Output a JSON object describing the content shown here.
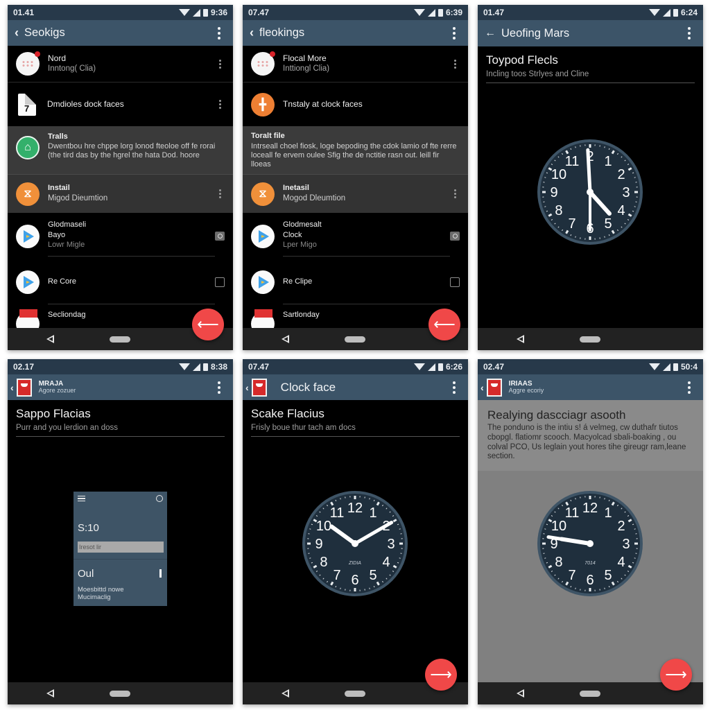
{
  "colors": {
    "status_bar": "#27394a",
    "app_bar": "#3c5468",
    "fab": "#f04848",
    "clock_face": "#1f2f3d",
    "clock_ring": "#3e5466",
    "screen_bg": "#000000",
    "highlight_row": "#3b3b3b",
    "gray_panel": "#808080"
  },
  "screens": [
    {
      "status": {
        "left_time": "01.41",
        "right_time": "9:36"
      },
      "appbar": {
        "back_icon": "chevron-left",
        "title": "Seokigs",
        "menu_icon": "more-vertical"
      },
      "list": [
        {
          "icon": "notification-dots-icon",
          "title": "Nord",
          "subtitle": "Inntong( Clia)",
          "action": "more-vertical"
        },
        {
          "icon": "calendar-document-icon",
          "icon_text": "7",
          "title": "Dmdioles dock faces",
          "action": "more-vertical"
        },
        {
          "icon": "clock-grid-icon",
          "title": "Tralls",
          "body": "Dwentbou hre chppe lorg lonod fteoloe off fe rorai (the tird das by the hgrel the hata Dod. hoore",
          "highlight": true
        },
        {
          "icon": "hourglass-icon",
          "title": "Instail",
          "subtitle": "Migod Dieumtion",
          "action": "more-vertical",
          "highlight": true
        },
        {
          "icon": "play-store-icon",
          "title": "Glodmaseli",
          "subtitle": "Bayo",
          "subtitle2": "Lowr Migle",
          "action": "camera"
        },
        {
          "icon": "play-store-icon",
          "title": "Re Core",
          "action": "checkbox"
        },
        {
          "icon": "calendar-icon",
          "title": "Secliondag"
        }
      ],
      "fab": {
        "icon": "arrow-left"
      }
    },
    {
      "status": {
        "left_time": "07.47",
        "right_time": "6:39"
      },
      "appbar": {
        "back_icon": "chevron-left",
        "title": "fleokings",
        "menu_icon": "more-vertical"
      },
      "list": [
        {
          "icon": "notification-dots-icon",
          "title": "Flocal More",
          "subtitle": "Inttiongl Clia)",
          "action": "more-vertical"
        },
        {
          "icon": "clock-grid-icon",
          "title": "Tnstaly at clock faces"
        },
        {
          "title": "Toralt file",
          "body": "Intrseall choel fiosk, loge bepoding the cdok lamio of fte rerre loceall fe ervem oulee Sfig the de nctitie rasn out. leill fir lloeas",
          "highlight": true
        },
        {
          "icon": "hourglass-icon",
          "title": "Inetasil",
          "subtitle": "Mogod Dleumtion",
          "action": "more-vertical",
          "highlight": true
        },
        {
          "icon": "play-store-icon",
          "title": "Glodmesalt",
          "subtitle": "Clock",
          "subtitle2": "Lper Migo",
          "action": "camera"
        },
        {
          "icon": "play-store-icon",
          "title": "Re Clipe",
          "action": "checkbox"
        },
        {
          "icon": "calendar-icon",
          "title": "Sartlonday"
        }
      ],
      "fab": {
        "icon": "arrow-left"
      }
    },
    {
      "status": {
        "left_time": "01.47",
        "right_time": "6:24"
      },
      "appbar": {
        "back_icon": "arrow-left",
        "title": "Ueofing Mars",
        "menu_icon": "more-vertical"
      },
      "heading": "Toypod Flecls",
      "subheading": "Incling toos Strlyes and Cline",
      "clock": {
        "hour_hand_hour": 4.6,
        "minute_hand_minute": 59.5,
        "second_hand_second": 30,
        "numerals": [
          "2",
          "1",
          "2",
          "3",
          "4",
          "5",
          "6",
          "7",
          "8",
          "9",
          "10",
          "11"
        ]
      }
    },
    {
      "status": {
        "left_time": "02.17",
        "right_time": "8:38"
      },
      "appbar": {
        "back_icon": "chevron-left",
        "title": "MRAJA",
        "subtitle": "Agore zozuer",
        "menu_icon": "more-vertical"
      },
      "heading": "Sappo Flacias",
      "subheading": "Purr and you lerdion an doss",
      "widget": {
        "menu_icon": "hamburger-menu",
        "power_icon": "power",
        "time": "S:10",
        "input_text": "Iresot lir",
        "label": "Oul",
        "description_line1": "Moesbittd nowe",
        "description_line2": "Mucimaclig"
      }
    },
    {
      "status": {
        "left_time": "07.47",
        "right_time": "6:26"
      },
      "appbar": {
        "back_icon": "chevron-left",
        "title": "Clock face",
        "menu_icon": "more-vertical"
      },
      "heading": "Scake Flacius",
      "subheading": "Frisly boue thur tach am docs",
      "clock": {
        "hour_hand_hour": 10.2,
        "minute_hand_minute": 10,
        "brand": "ZIDIA",
        "numerals": [
          "12",
          "1",
          "2",
          "3",
          "4",
          "5",
          "6",
          "7",
          "8",
          "9",
          "10",
          "11"
        ]
      },
      "fab": {
        "icon": "arrow-right"
      }
    },
    {
      "status": {
        "left_time": "02.47",
        "right_time": "50:4"
      },
      "appbar": {
        "back_icon": "chevron-left",
        "title": "IRIAAS",
        "subtitle": "Aggre ecoriy",
        "menu_icon": "more-vertical"
      },
      "heading": "Realying dascciagr asooth",
      "body": "The ponduno is the intiu s! á velmeg, cw duthafr tiutos cbopgl. flatiomr scooch. Macyolcad sbali-boaking , ou colval PCO, Us leglain yout hores tihe gireugr ram,leane section.",
      "clock": {
        "hour_hand_hour": 9.3,
        "minute_hand_minute": 46.5,
        "brand": "7014",
        "numerals": [
          "12",
          "1",
          "2",
          "3",
          "4",
          "5",
          "6",
          "7",
          "8",
          "9",
          "10",
          "11"
        ]
      },
      "fab": {
        "icon": "arrow-right"
      }
    }
  ]
}
